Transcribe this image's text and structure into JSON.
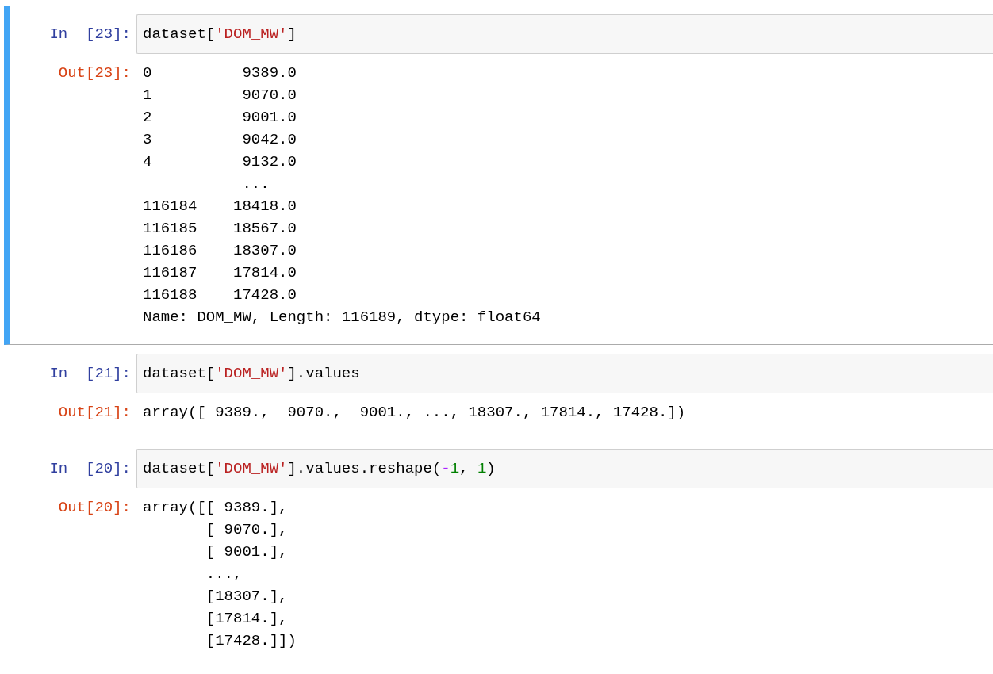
{
  "cells": [
    {
      "selected": true,
      "input_prompt": "In  [23]:",
      "input": [
        {
          "kind": "plain",
          "text": "dataset["
        },
        {
          "kind": "string",
          "text": "'DOM_MW'"
        },
        {
          "kind": "plain",
          "text": "]"
        }
      ],
      "output_prompt": "Out[23]:",
      "output": [
        "0          9389.0",
        "1          9070.0",
        "2          9001.0",
        "3          9042.0",
        "4          9132.0",
        "           ...",
        "116184    18418.0",
        "116185    18567.0",
        "116186    18307.0",
        "116187    17814.0",
        "116188    17428.0",
        "Name: DOM_MW, Length: 116189, dtype: float64"
      ]
    },
    {
      "selected": false,
      "input_prompt": "In  [21]:",
      "input": [
        {
          "kind": "plain",
          "text": "dataset["
        },
        {
          "kind": "string",
          "text": "'DOM_MW'"
        },
        {
          "kind": "plain",
          "text": "].values"
        }
      ],
      "output_prompt": "Out[21]:",
      "output": [
        "array([ 9389.,  9070.,  9001., ..., 18307., 17814., 17428.])"
      ]
    },
    {
      "selected": false,
      "input_prompt": "In  [20]:",
      "input": [
        {
          "kind": "plain",
          "text": "dataset["
        },
        {
          "kind": "string",
          "text": "'DOM_MW'"
        },
        {
          "kind": "plain",
          "text": "].values.reshape("
        },
        {
          "kind": "operator",
          "text": "-"
        },
        {
          "kind": "number",
          "text": "1"
        },
        {
          "kind": "plain",
          "text": ", "
        },
        {
          "kind": "number",
          "text": "1"
        },
        {
          "kind": "plain",
          "text": ")"
        }
      ],
      "output_prompt": "Out[20]:",
      "output": [
        "array([[ 9389.],",
        "       [ 9070.],",
        "       [ 9001.],",
        "       ...,",
        "       [18307.],",
        "       [17814.],",
        "       [17428.]])"
      ]
    }
  ]
}
